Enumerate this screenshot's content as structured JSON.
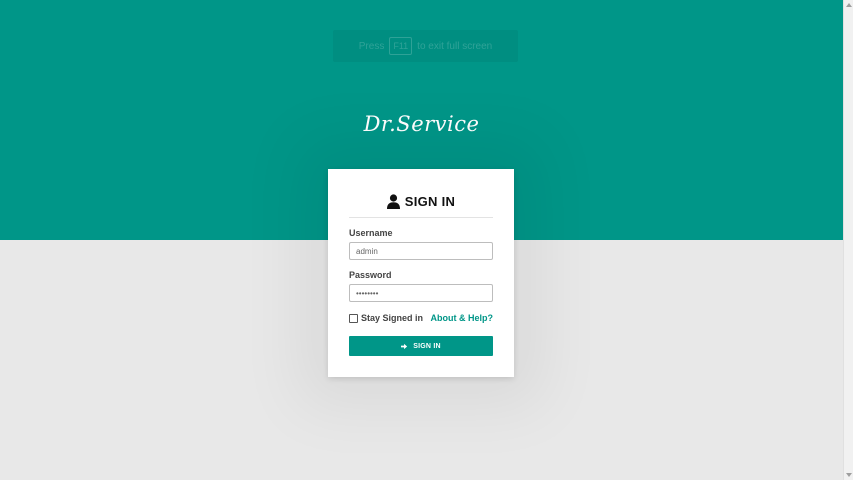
{
  "fullscreen_notice": {
    "prefix": "Press",
    "key": "F11",
    "suffix": "to exit full screen"
  },
  "brand": {
    "logo_text": "Dr.Service"
  },
  "login": {
    "title": "SIGN IN",
    "username_label": "Username",
    "username_value": "admin",
    "password_label": "Password",
    "password_value": "••••••••",
    "remember_label": "Stay Signed in",
    "remember_checked": false,
    "help_link": "About & Help?",
    "submit_label": "SIGN IN",
    "icons": {
      "title_icon": "user-icon",
      "submit_icon": "sign-in-icon"
    }
  },
  "colors": {
    "accent": "#009688",
    "background": "#e8e8e8",
    "card": "#ffffff"
  }
}
